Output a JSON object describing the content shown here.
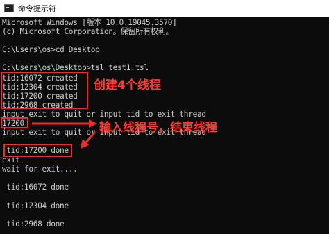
{
  "window": {
    "title": "命令提示符"
  },
  "console": {
    "lines": [
      "Microsoft Windows [版本 10.0.19045.3570]",
      "(c) Microsoft Corporation。保留所有权利。",
      "",
      "C:\\Users\\os>cd Desktop",
      "",
      "C:\\Users\\os\\Desktop>tsl test1.tsl",
      "tid:16072 created",
      "tid:12304 created",
      "tid:17200 created",
      "tid:2968 created",
      "input exit to quit or input tid to exit thread",
      "17200",
      "input exit to quit or input tid to exit thread",
      "",
      " tid:17200 done",
      "exit",
      "wait for exit....",
      "",
      " tid:16072 done",
      "",
      " tid:12304 done",
      "",
      " tid:2968 done"
    ]
  },
  "annotations": {
    "create_note": "创建4个线程",
    "input_note": "输入线程号，结束线程",
    "color": "#e5312d"
  }
}
